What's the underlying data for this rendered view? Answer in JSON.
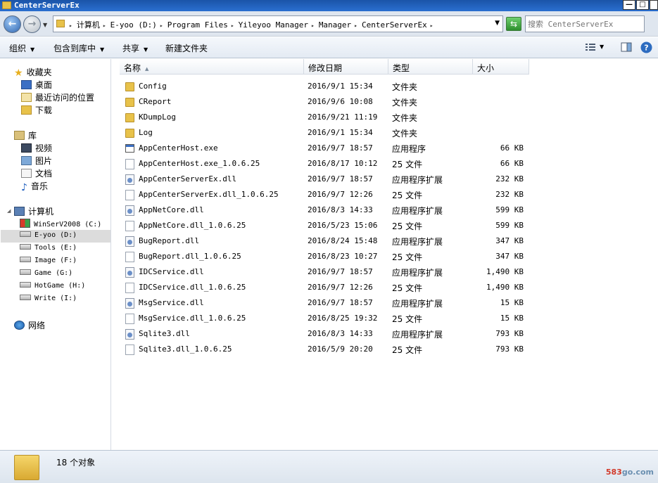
{
  "window": {
    "title": "CenterServerEx",
    "min": "—",
    "max": "□",
    "close": "✕"
  },
  "address": {
    "crumbs": [
      "计算机",
      "E-yoo (D:)",
      "Program Files",
      "Yileyoo Manager",
      "Manager",
      "CenterServerEx"
    ],
    "search_placeholder": "搜索 CenterServerEx"
  },
  "toolbar": {
    "organize": "组织",
    "include_library": "包含到库中",
    "share": "共享",
    "new_folder": "新建文件夹"
  },
  "nav": {
    "favorites": {
      "label": "收藏夹",
      "items": [
        "桌面",
        "最近访问的位置",
        "下载"
      ]
    },
    "libraries": {
      "label": "库",
      "items": [
        "视频",
        "图片",
        "文档",
        "音乐"
      ]
    },
    "computer": {
      "label": "计算机",
      "drives": [
        "WinSerV2008 (C:)",
        "E-yoo (D:)",
        "Tools (E:)",
        "Image (F:)",
        "Game (G:)",
        "HotGame (H:)",
        "Write (I:)"
      ],
      "selected": "E-yoo (D:)"
    },
    "network": {
      "label": "网络"
    }
  },
  "columns": {
    "name": "名称",
    "modified": "修改日期",
    "type": "类型",
    "size": "大小"
  },
  "files": [
    {
      "name": "Config",
      "modified": "2016/9/1 15:34",
      "type": "文件夹",
      "size": "",
      "icon": "folder"
    },
    {
      "name": "CReport",
      "modified": "2016/9/6 10:08",
      "type": "文件夹",
      "size": "",
      "icon": "folder"
    },
    {
      "name": "KDumpLog",
      "modified": "2016/9/21 11:19",
      "type": "文件夹",
      "size": "",
      "icon": "folder"
    },
    {
      "name": "Log",
      "modified": "2016/9/1 15:34",
      "type": "文件夹",
      "size": "",
      "icon": "folder"
    },
    {
      "name": "AppCenterHost.exe",
      "modified": "2016/9/7 18:57",
      "type": "应用程序",
      "size": "66 KB",
      "icon": "exe"
    },
    {
      "name": "AppCenterHost.exe_1.0.6.25",
      "modified": "2016/8/17 10:12",
      "type": "25 文件",
      "size": "66 KB",
      "icon": "file"
    },
    {
      "name": "AppCenterServerEx.dll",
      "modified": "2016/9/7 18:57",
      "type": "应用程序扩展",
      "size": "232 KB",
      "icon": "dll"
    },
    {
      "name": "AppCenterServerEx.dll_1.0.6.25",
      "modified": "2016/9/7 12:26",
      "type": "25 文件",
      "size": "232 KB",
      "icon": "file"
    },
    {
      "name": "AppNetCore.dll",
      "modified": "2016/8/3 14:33",
      "type": "应用程序扩展",
      "size": "599 KB",
      "icon": "dll"
    },
    {
      "name": "AppNetCore.dll_1.0.6.25",
      "modified": "2016/5/23 15:06",
      "type": "25 文件",
      "size": "599 KB",
      "icon": "file"
    },
    {
      "name": "BugReport.dll",
      "modified": "2016/8/24 15:48",
      "type": "应用程序扩展",
      "size": "347 KB",
      "icon": "dll"
    },
    {
      "name": "BugReport.dll_1.0.6.25",
      "modified": "2016/8/23 10:27",
      "type": "25 文件",
      "size": "347 KB",
      "icon": "file"
    },
    {
      "name": "IDCService.dll",
      "modified": "2016/9/7 18:57",
      "type": "应用程序扩展",
      "size": "1,490 KB",
      "icon": "dll"
    },
    {
      "name": "IDCService.dll_1.0.6.25",
      "modified": "2016/9/7 12:26",
      "type": "25 文件",
      "size": "1,490 KB",
      "icon": "file"
    },
    {
      "name": "MsgService.dll",
      "modified": "2016/9/7 18:57",
      "type": "应用程序扩展",
      "size": "15 KB",
      "icon": "dll"
    },
    {
      "name": "MsgService.dll_1.0.6.25",
      "modified": "2016/8/25 19:32",
      "type": "25 文件",
      "size": "15 KB",
      "icon": "file"
    },
    {
      "name": "Sqlite3.dll",
      "modified": "2016/8/3 14:33",
      "type": "应用程序扩展",
      "size": "793 KB",
      "icon": "dll"
    },
    {
      "name": "Sqlite3.dll_1.0.6.25",
      "modified": "2016/5/9 20:20",
      "type": "25 文件",
      "size": "793 KB",
      "icon": "file"
    }
  ],
  "status": {
    "count": "18 个对象",
    "watermark_num": "583",
    "watermark_rest": "go.com"
  }
}
